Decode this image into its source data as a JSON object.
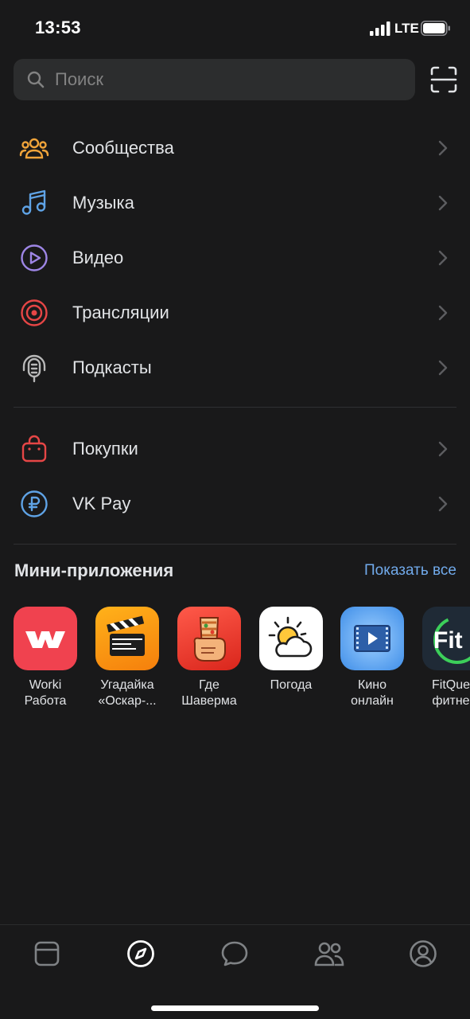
{
  "status_bar": {
    "time": "13:53",
    "network": "LTE"
  },
  "search": {
    "placeholder": "Поиск"
  },
  "menu_primary": [
    {
      "label": "Сообщества",
      "icon": "communities-icon",
      "color": "#f0a43a"
    },
    {
      "label": "Музыка",
      "icon": "music-icon",
      "color": "#5fa3e6"
    },
    {
      "label": "Видео",
      "icon": "video-play-icon",
      "color": "#9e86e6"
    },
    {
      "label": "Трансляции",
      "icon": "broadcast-icon",
      "color": "#e64646"
    },
    {
      "label": "Подкасты",
      "icon": "podcast-icon",
      "color": "#b8b8b8"
    }
  ],
  "menu_secondary": [
    {
      "label": "Покупки",
      "icon": "shopping-bag-icon",
      "color": "#e64646"
    },
    {
      "label": "VK Pay",
      "icon": "ruble-coin-icon",
      "color": "#5fa3e6"
    }
  ],
  "mini_apps": {
    "title": "Мини-приложения",
    "show_all": "Показать все",
    "items": [
      {
        "line1": "Worki",
        "line2": "Работа",
        "icon": "worki-logo-icon"
      },
      {
        "line1": "Угадайка",
        "line2": "«Оскар-...",
        "icon": "clapperboard-icon"
      },
      {
        "line1": "Где",
        "line2": "Шаверма",
        "icon": "shawarma-icon"
      },
      {
        "line1": "Погода",
        "line2": "",
        "icon": "weather-sun-cloud-icon"
      },
      {
        "line1": "Кино",
        "line2": "онлайн",
        "icon": "movie-screen-icon"
      },
      {
        "line1": "FitQues",
        "line2": "фитнес",
        "icon": "fitquest-logo-icon"
      }
    ]
  },
  "tab_bar": [
    {
      "name": "news",
      "icon": "feed-icon"
    },
    {
      "name": "explore",
      "icon": "compass-icon",
      "active": true
    },
    {
      "name": "messages",
      "icon": "chat-bubble-icon"
    },
    {
      "name": "friends",
      "icon": "friends-icon"
    },
    {
      "name": "profile",
      "icon": "profile-icon"
    }
  ],
  "colors": {
    "background": "#19191a",
    "accent": "#71aaeb",
    "text": "#e1e3e6"
  }
}
